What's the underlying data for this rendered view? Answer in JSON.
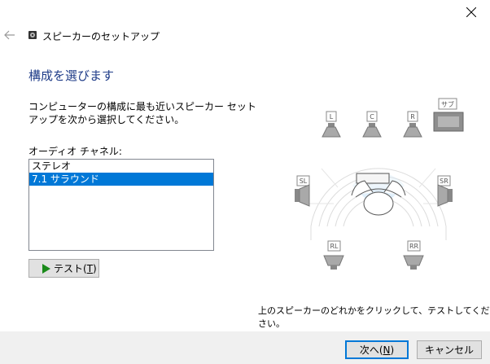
{
  "window": {
    "title": "スピーカーのセットアップ",
    "close_icon": "close-icon",
    "back_icon": "back-arrow-icon"
  },
  "page": {
    "heading": "構成を選びます",
    "description": "コンピューターの構成に最も近いスピーカー セットアップを次から選択してください。",
    "channel_label": "オーディオ チャネル:"
  },
  "channels": {
    "items": [
      "ステレオ",
      "7.1 サラウンド"
    ],
    "selected": "7.1 サラウンド"
  },
  "test_button": {
    "label": "テスト(",
    "mnemonic": "T",
    "suffix": ")"
  },
  "speakers": {
    "front_left": "L",
    "center": "C",
    "front_right": "R",
    "subwoofer": "サブ",
    "side_left": "SL",
    "side_right": "SR",
    "rear_left": "RL",
    "rear_right": "RR"
  },
  "hint": "上のスピーカーのどれかをクリックして、テストしてください。",
  "footer": {
    "next_label": "次へ(",
    "next_mnemonic": "N",
    "next_suffix": ")",
    "cancel_label": "キャンセル"
  },
  "colors": {
    "heading": "#1f3c88",
    "selection": "#0078d7",
    "footer_bg": "#f0f0f0",
    "play": "#1a8a1a"
  }
}
